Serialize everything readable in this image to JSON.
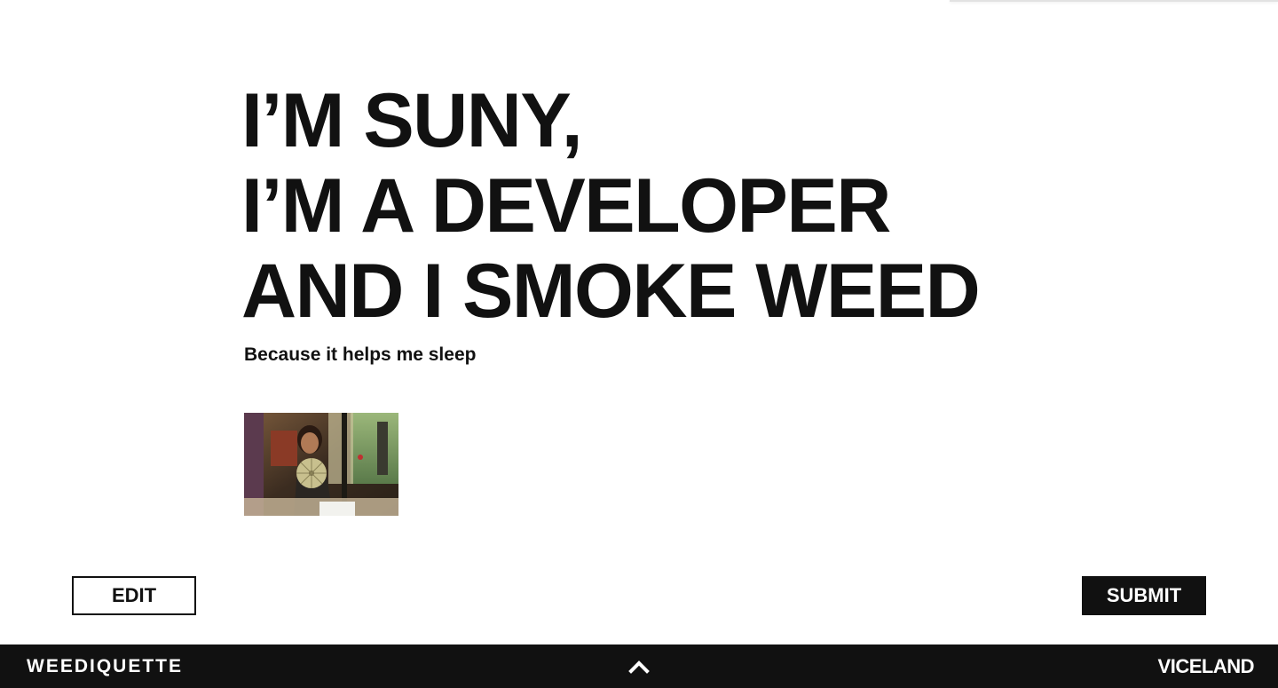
{
  "headline": {
    "line1": "I’M SUNY,",
    "line2": "I’M A DEVELOPER",
    "line3": "AND I SMOKE WEED"
  },
  "subheadline": "Because it helps me sleep",
  "photo": {
    "alt": "uploaded photo thumbnail"
  },
  "actions": {
    "edit_label": "EDIT",
    "submit_label": "SUBMIT"
  },
  "footer": {
    "brand_left": "WEEDIQUETTE",
    "brand_right": "VICELAND",
    "scroll_top_icon": "chevron-up-icon"
  },
  "colors": {
    "text": "#111111",
    "background": "#ffffff",
    "footer_bg": "#111111",
    "footer_text": "#ffffff"
  }
}
